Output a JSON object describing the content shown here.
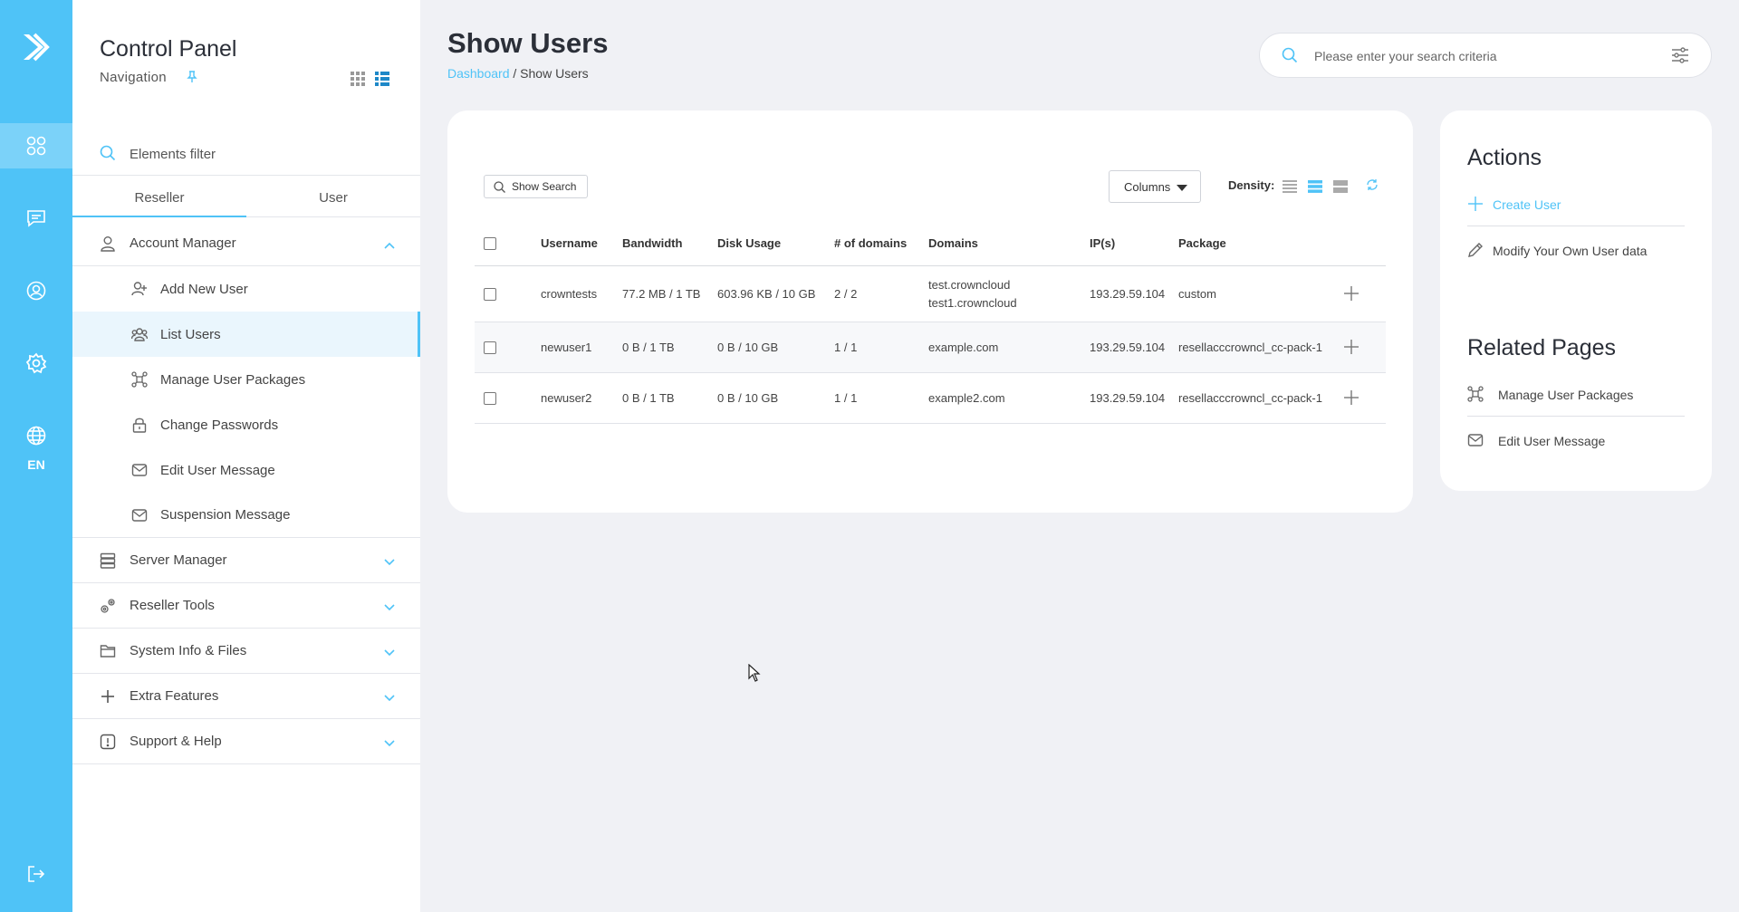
{
  "rail": {
    "language": "EN",
    "items": [
      "dashboard-icon",
      "messages-icon",
      "account-icon",
      "settings-icon",
      "globe-icon",
      "logout-icon"
    ]
  },
  "nav": {
    "title": "Control Panel",
    "subtitle": "Navigation",
    "filter_label": "Elements filter",
    "tabs": [
      "Reseller",
      "User"
    ],
    "account_manager": {
      "label": "Account Manager",
      "items": [
        {
          "label": "Add New User",
          "icon": "user-plus-icon"
        },
        {
          "label": "List Users",
          "icon": "users-icon"
        },
        {
          "label": "Manage User Packages",
          "icon": "packages-icon"
        },
        {
          "label": "Change Passwords",
          "icon": "lock-icon"
        },
        {
          "label": "Edit User Message",
          "icon": "mail-icon"
        },
        {
          "label": "Suspension Message",
          "icon": "mail-icon"
        }
      ]
    },
    "sections": [
      {
        "label": "Server Manager",
        "icon": "server-icon"
      },
      {
        "label": "Reseller Tools",
        "icon": "tools-icon"
      },
      {
        "label": "System Info & Files",
        "icon": "folder-icon"
      },
      {
        "label": "Extra Features",
        "icon": "plus-icon"
      },
      {
        "label": "Support & Help",
        "icon": "alert-icon"
      }
    ]
  },
  "header": {
    "title": "Show Users",
    "breadcrumb_link": "Dashboard",
    "breadcrumb_sep": " / ",
    "breadcrumb_current": "Show Users",
    "search_placeholder": "Please enter your search criteria"
  },
  "table": {
    "show_search": "Show Search",
    "columns_label": "Columns",
    "density_label": "Density:",
    "headers": [
      "Username",
      "Bandwidth",
      "Disk Usage",
      "# of domains",
      "Domains",
      "IP(s)",
      "Package"
    ],
    "rows": [
      {
        "username": "crowntests",
        "bandwidth": "77.2 MB / 1 TB",
        "disk": "603.96 KB / 10 GB",
        "domains_count": "2 / 2",
        "domains": [
          "test.crowncloud",
          "test1.crowncloud"
        ],
        "ip": "193.29.59.104",
        "package": "custom"
      },
      {
        "username": "newuser1",
        "bandwidth": "0 B / 1 TB",
        "disk": "0 B / 10 GB",
        "domains_count": "1 / 1",
        "domains": [
          "example.com"
        ],
        "ip": "193.29.59.104",
        "package": "resellacccrowncl_cc-pack-1"
      },
      {
        "username": "newuser2",
        "bandwidth": "0 B / 1 TB",
        "disk": "0 B / 10 GB",
        "domains_count": "1 / 1",
        "domains": [
          "example2.com"
        ],
        "ip": "193.29.59.104",
        "package": "resellacccrowncl_cc-pack-1"
      }
    ]
  },
  "actions": {
    "title": "Actions",
    "items": [
      "Create User",
      "Modify Your Own User data"
    ]
  },
  "related": {
    "title": "Related Pages",
    "items": [
      "Manage User Packages",
      "Edit User Message"
    ]
  },
  "colors": {
    "accent": "#4fc3f7",
    "background": "#f0f1f5"
  }
}
